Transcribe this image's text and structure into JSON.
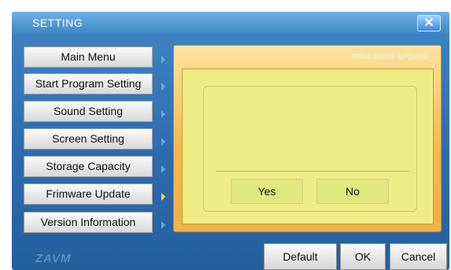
{
  "window": {
    "title": "SETTING",
    "close_icon": "close-icon",
    "close_glyph": "✕"
  },
  "menu": {
    "items": [
      {
        "label": "Main Menu",
        "active": false
      },
      {
        "label": "Start Program Setting",
        "active": false
      },
      {
        "label": "Sound Setting",
        "active": false
      },
      {
        "label": "Screen Setting",
        "active": false
      },
      {
        "label": "Storage Capacity",
        "active": false
      },
      {
        "label": "Frimware Update",
        "active": true
      },
      {
        "label": "Version Information",
        "active": false
      }
    ]
  },
  "panel": {
    "title": "FIRM WARE UPDATE",
    "message": "",
    "yes_label": "Yes",
    "no_label": "No"
  },
  "footer": {
    "logo_text": "ZAVM",
    "default_label": "Default",
    "ok_label": "OK",
    "cancel_label": "Cancel"
  },
  "colors": {
    "window_blue": "#2e6cae",
    "panel_orange": "#f3b94d",
    "panel_yellow": "#eded86",
    "active_arrow": "#f6d35a"
  }
}
